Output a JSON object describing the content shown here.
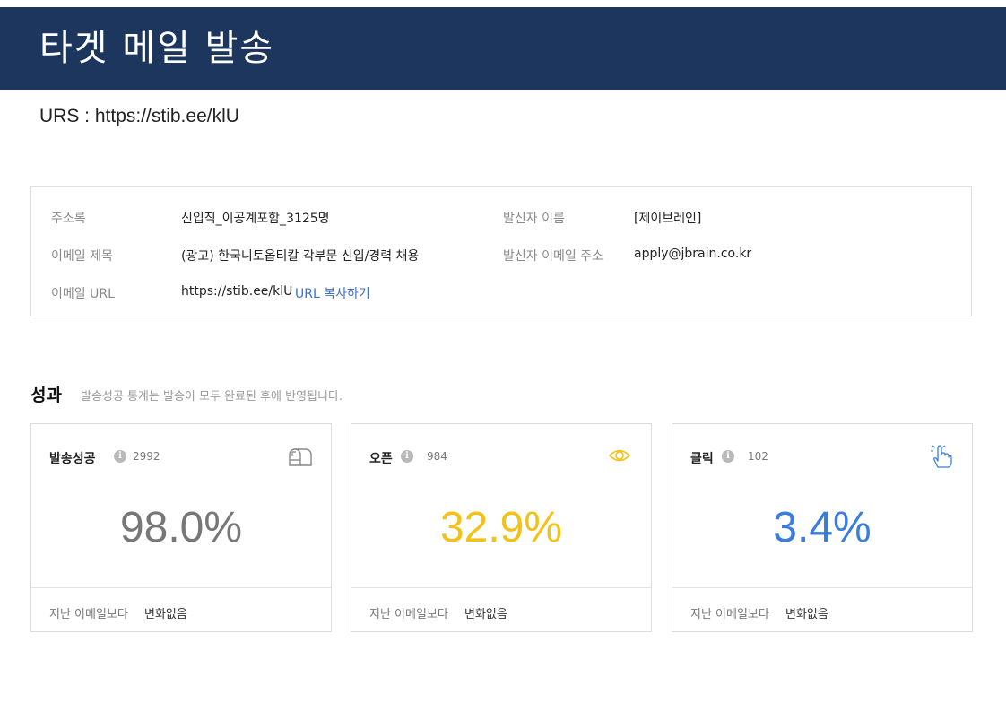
{
  "header": {
    "title": "타겟 메일 발송"
  },
  "urs_line": "URS : https://stib.ee/klU",
  "info": {
    "address_book_label": "주소록",
    "address_book_value": "신입직_이공계포함_3125명",
    "sender_name_label": "발신자 이름",
    "sender_name_value": "[제이브레인]",
    "subject_label": "이메일 제목",
    "subject_value": "(광고) 한국니토옵티칼 각부문 신입/경력 채용",
    "sender_email_label": "발신자 이메일 주소",
    "sender_email_value": "apply@jbrain.co.kr",
    "url_label": "이메일 URL",
    "url_value": "https://stib.ee/klU",
    "copy_url_label": "URL 복사하기"
  },
  "performance": {
    "title": "성과",
    "note": "발송성공 통계는 발송이 모두 완료된 후에 반영됩니다.",
    "cards": [
      {
        "name": "발송성공",
        "count": "2992",
        "percent": "98.0%",
        "icon": "mailbox-icon",
        "color": "#777777",
        "foot_label": "지난 이메일보다",
        "foot_value": "변화없음"
      },
      {
        "name": "오픈",
        "count": "984",
        "percent": "32.9%",
        "icon": "eye-icon",
        "color": "#f2c21b",
        "foot_label": "지난 이메일보다",
        "foot_value": "변화없음"
      },
      {
        "name": "클릭",
        "count": "102",
        "percent": "3.4%",
        "icon": "pointer-hand-icon",
        "color": "#3b7ddd",
        "foot_label": "지난 이메일보다",
        "foot_value": "변화없음"
      }
    ]
  }
}
